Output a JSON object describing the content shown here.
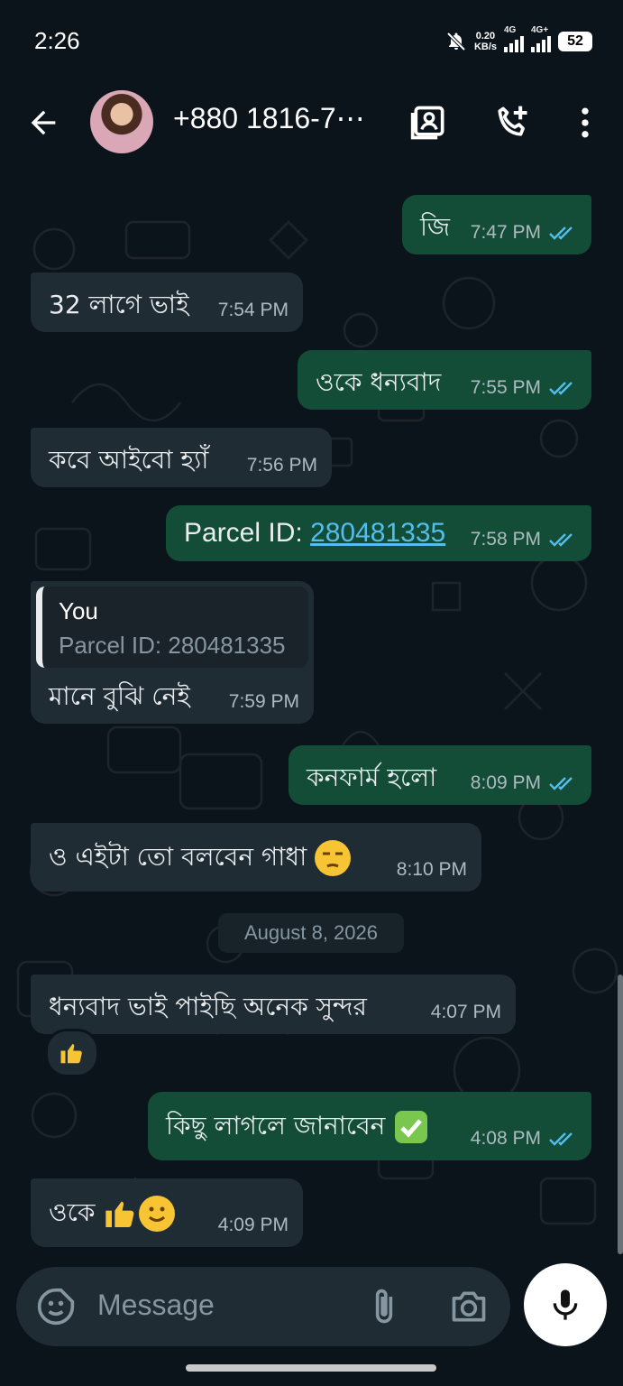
{
  "status_bar": {
    "time": "2:26",
    "net_speed_value": "0.20",
    "net_speed_unit": "KB/s",
    "sim1_label": "4G",
    "sim2_label": "4G+",
    "battery": "52"
  },
  "header": {
    "contact": "+880 1816-7⋯",
    "icons": [
      "back-arrow-icon",
      "contact-card-icon",
      "add-call-icon",
      "more-vert-icon"
    ]
  },
  "messages": [
    {
      "dir": "out",
      "text": "জি",
      "time": "7:47 PM"
    },
    {
      "dir": "in",
      "text": "32 লাগে ভাই",
      "time": "7:54 PM"
    },
    {
      "dir": "out",
      "text": "ওকে ধন্যবাদ",
      "time": "7:55 PM"
    },
    {
      "dir": "in",
      "text": "কবে আইবো হ্যাঁ",
      "time": "7:56 PM"
    },
    {
      "dir": "out",
      "text_prefix": "Parcel ID: ",
      "link": "280481335",
      "time": "7:58 PM"
    },
    {
      "dir": "in",
      "quote_name": "You",
      "quote_text": "Parcel ID: 280481335",
      "text": "মানে বুঝি নেই",
      "time": "7:59 PM"
    },
    {
      "dir": "out",
      "text": "কনফার্ম হলো",
      "time": "8:09 PM"
    },
    {
      "dir": "in",
      "text": "ও এইটা তো বলবেন গাধা",
      "emoji": "unamused-face",
      "time": "8:10 PM"
    },
    {
      "dir": "in",
      "text": "ধন্যবাদ ভাই পাইছি অনেক সুন্দর",
      "time": "4:07 PM",
      "reaction": "thumbs-up"
    },
    {
      "dir": "out",
      "text": "কিছু লাগলে জানাবেন",
      "emoji": "check-mark-button",
      "time": "4:08 PM"
    },
    {
      "dir": "in",
      "text": "ওকে",
      "emoji": "thumbs-up + slightly-smiling-face",
      "time": "4:09 PM"
    }
  ],
  "date_separator": "August 8, 2026",
  "composer": {
    "placeholder": "Message",
    "icons": [
      "sticker-icon",
      "attach-icon",
      "camera-icon",
      "mic-icon"
    ]
  },
  "colors": {
    "background": "#0b141a",
    "outgoing": "#144d37",
    "incoming": "#202c33",
    "read_ticks": "#53bdeb",
    "meta": "#aebac1"
  }
}
